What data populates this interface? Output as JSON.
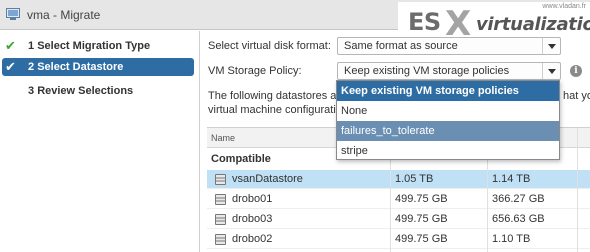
{
  "window": {
    "title": "vma - Migrate"
  },
  "logo": {
    "url": "www.vladan.fr",
    "brand_prefix": "ES",
    "brand_x": "X",
    "brand_suffix": "virtualization"
  },
  "steps": [
    {
      "number": "1",
      "label": "Select Migration Type",
      "completed": true,
      "active": false
    },
    {
      "number": "2",
      "label": "Select Datastore",
      "completed": true,
      "active": true
    },
    {
      "number": "3",
      "label": "Review Selections",
      "completed": false,
      "active": false
    }
  ],
  "form": {
    "disk_format_label": "Select virtual disk format:",
    "disk_format_value": "Same format as source",
    "storage_policy_label": "VM Storage Policy:",
    "storage_policy_value": "Keep existing VM storage policies",
    "description_line1": "The following datastores a",
    "description_line1_end": "hat you",
    "description_line2": "virtual machine configurati"
  },
  "policy_dropdown": {
    "options": [
      {
        "label": "Keep existing VM storage policies",
        "state": "selected"
      },
      {
        "label": "None",
        "state": "normal"
      },
      {
        "label": "failures_to_tolerate",
        "state": "hover"
      },
      {
        "label": "stripe",
        "state": "normal"
      }
    ]
  },
  "datastore_table": {
    "columns": [
      "Name"
    ],
    "group_label": "Compatible",
    "rows": [
      {
        "name": "vsanDatastore",
        "capacity": "1.05 TB",
        "free": "1.14 TB",
        "selected": true
      },
      {
        "name": "drobo01",
        "capacity": "499.75 GB",
        "free": "366.27 GB",
        "selected": false
      },
      {
        "name": "drobo03",
        "capacity": "499.75 GB",
        "free": "656.63 GB",
        "selected": false
      },
      {
        "name": "drobo02",
        "capacity": "499.75 GB",
        "free": "1.10 TB",
        "selected": false
      }
    ]
  },
  "colors": {
    "accent": "#2e6da4",
    "check_green": "#3fa435",
    "row_selected": "#bfe0f5"
  }
}
